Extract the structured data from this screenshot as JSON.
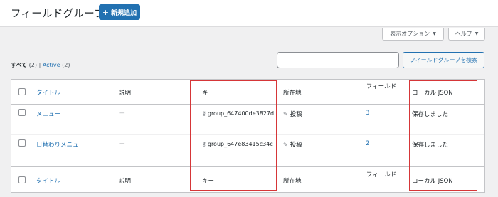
{
  "header": {
    "title": "フィールドグループ",
    "add_new_label": "新規追加"
  },
  "screen_options": {
    "display_options_label": "表示オプション",
    "help_label": "ヘルプ"
  },
  "filters": {
    "all_label": "すべて",
    "all_count": "(2)",
    "separator": "|",
    "active_label": "Active",
    "active_count": "(2)"
  },
  "search": {
    "placeholder": "",
    "button_label": "フィールドグループを検索"
  },
  "table": {
    "columns": {
      "title": "タイトル",
      "description": "説明",
      "key": "キー",
      "location": "所在地",
      "fields": "フィールド",
      "local_json": "ローカル JSON"
    },
    "rows": [
      {
        "title": "メニュー",
        "description": "—",
        "key": "group_647400de3827d",
        "location": "投稿",
        "fields": "3",
        "local_json": "保存しました"
      },
      {
        "title": "日替わりメニュー",
        "description": "—",
        "key": "group_647e83415c34c",
        "location": "投稿",
        "fields": "2",
        "local_json": "保存しました"
      }
    ]
  },
  "colors": {
    "accent": "#2271b1",
    "highlight": "#d63638"
  },
  "icons": {
    "key": "key-icon",
    "location": "pin-icon"
  }
}
